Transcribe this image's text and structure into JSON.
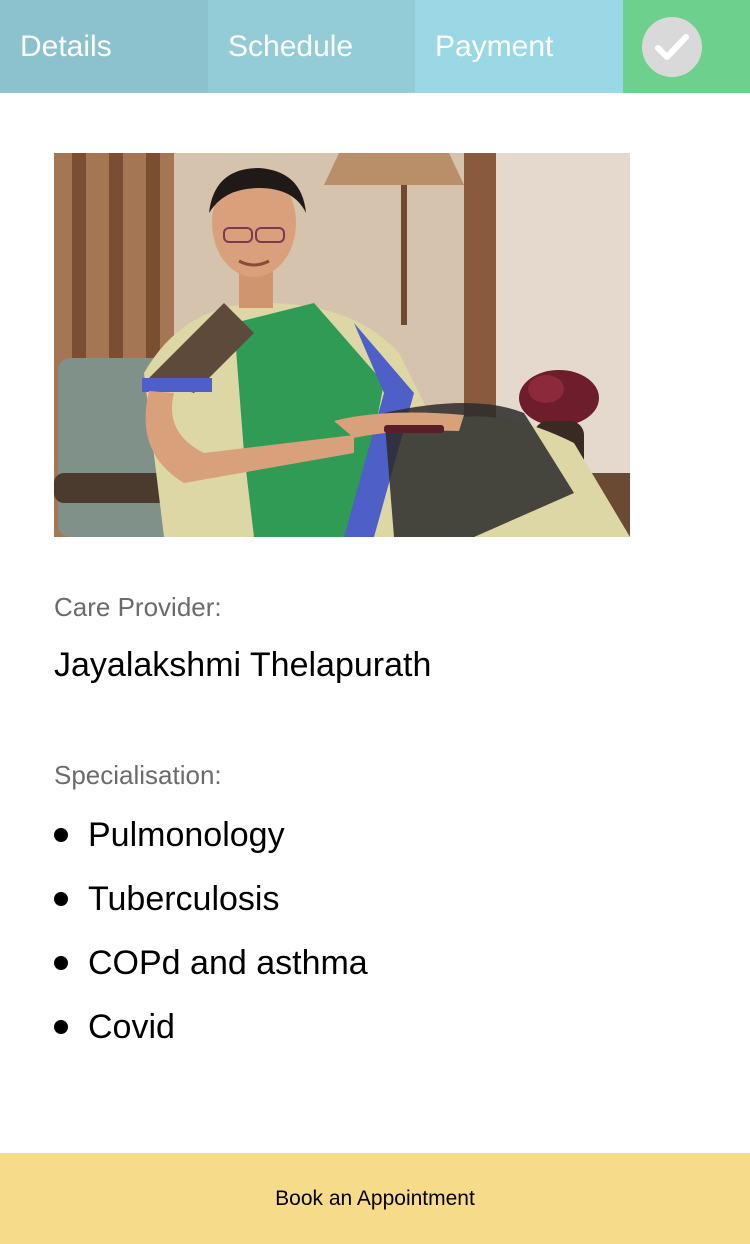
{
  "tabs": {
    "details": "Details",
    "schedule": "Schedule",
    "payment": "Payment",
    "done_icon": "check-icon"
  },
  "colors": {
    "tab_details": "#8cc2cd",
    "tab_schedule": "#93ccd7",
    "tab_payment": "#9ad8e5",
    "tab_done": "#6ed08d",
    "book_button": "#f6dc8a"
  },
  "provider": {
    "label": "Care Provider:",
    "name": "Jayalakshmi Thelapurath",
    "photo_icon": "provider-photo"
  },
  "specialisation": {
    "label": "Specialisation:",
    "items": [
      "Pulmonology",
      "Tuberculosis",
      "COPd and asthma",
      "Covid"
    ]
  },
  "actions": {
    "book_label": "Book an Appointment"
  }
}
